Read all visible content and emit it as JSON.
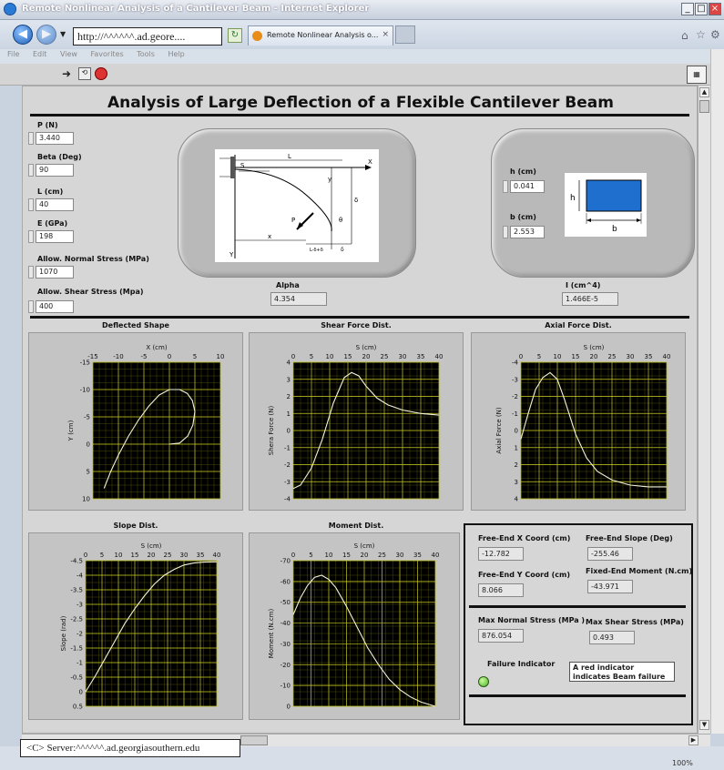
{
  "browser": {
    "title": "Remote Nonlinear Analysis of a Cantilever Beam - Internet Explorer",
    "url": "http://^^^^^^.ad.geore....",
    "tab": "Remote Nonlinear Analysis o...",
    "menu": [
      "File",
      "Edit",
      "View",
      "Favorites",
      "Tools",
      "Help"
    ],
    "status": "<C> Server:^^^^^^.ad.georgiasouthern.edu",
    "zoom": "100%",
    "icons": [
      "back-icon",
      "forward-icon",
      "refresh-icon",
      "home-icon",
      "star-icon",
      "gear-icon"
    ]
  },
  "app": {
    "title": "Analysis of Large Deflection of a Flexible Cantilever Beam",
    "inputs": [
      {
        "label": "P (N)",
        "value": "3.440"
      },
      {
        "label": "Beta (Deg)",
        "value": "90"
      },
      {
        "label": "L (cm)",
        "value": "40"
      },
      {
        "label": "E (GPa)",
        "value": "198"
      },
      {
        "label": "Allow. Normal Stress (MPa)",
        "value": "1070"
      },
      {
        "label": "Allow. Shear Stress (Mpa)",
        "value": "400"
      }
    ],
    "alpha": {
      "label": "Alpha",
      "value": "4.354"
    },
    "h": {
      "label": "h (cm)",
      "value": "0.041"
    },
    "b": {
      "label": "b (cm)",
      "value": "2.553"
    },
    "inertia": {
      "label": "I (cm^4)",
      "value": "1.466E-5"
    },
    "diagram_labels": {
      "L": "L",
      "x": "x",
      "y": "y",
      "X": "X",
      "Y": "Y",
      "S": "S",
      "P": "P",
      "theta": "θ",
      "delta": "δ",
      "dx": "L-δ+δ",
      "h": "h",
      "b": "b"
    },
    "results": {
      "free_x": {
        "label": "Free-End X Coord (cm)",
        "value": "-12.782"
      },
      "free_slope": {
        "label": "Free-End Slope (Deg)",
        "value": "-255.46"
      },
      "free_y": {
        "label": "Free-End Y Coord (cm)",
        "value": "8.066"
      },
      "fixed_moment": {
        "label": "Fixed-End Moment (N.cm)",
        "value": "-43.971"
      },
      "max_normal": {
        "label": "Max Normal Stress (MPa )",
        "value": "876.054"
      },
      "max_shear": {
        "label": "Max Shear Stress (MPa)",
        "value": "0.493"
      },
      "failure_label": "Failure Indicator",
      "failure_note": "A red indicator indicates Beam failure",
      "failure_color": "#4caf2a"
    }
  },
  "chart_data": [
    {
      "type": "line",
      "title": "Deflected Shape",
      "xlabel": "X (cm)",
      "ylabel": "Y (cm)",
      "xlim": [
        -15,
        10
      ],
      "ylim": [
        -15,
        10
      ],
      "xticks": [
        "-15",
        "-10",
        "-5",
        "0",
        "5",
        "10"
      ],
      "yticks": [
        "-15",
        "-10",
        "-5",
        "0",
        "5",
        "10"
      ],
      "y_reversed": true,
      "x": [
        -12.8,
        -11.5,
        -10,
        -8,
        -6,
        -4,
        -2,
        0,
        2,
        3.5,
        4.5,
        5,
        4.6,
        3.6,
        2,
        0
      ],
      "y": [
        8.1,
        5,
        2,
        -1.5,
        -4.5,
        -7,
        -9,
        -10,
        -10,
        -9.3,
        -8,
        -6,
        -3.5,
        -1.5,
        -0.2,
        0
      ]
    },
    {
      "type": "line",
      "title": "Shear Force Dist.",
      "xlabel": "S (cm)",
      "ylabel": "Shera Force (N)",
      "xlim": [
        0,
        40
      ],
      "ylim": [
        -4,
        4
      ],
      "xticks": [
        "0",
        "5",
        "10",
        "15",
        "20",
        "25",
        "30",
        "35",
        "40"
      ],
      "yticks": [
        "4",
        "3",
        "2",
        "1",
        "0",
        "-1",
        "-2",
        "-3",
        "-4"
      ],
      "x": [
        0,
        2,
        5,
        8,
        11,
        14,
        16,
        18,
        20,
        23,
        26,
        30,
        35,
        40
      ],
      "y": [
        -3.4,
        -3.2,
        -2.2,
        -0.5,
        1.6,
        3.1,
        3.4,
        3.2,
        2.6,
        1.9,
        1.5,
        1.2,
        1.0,
        0.9
      ]
    },
    {
      "type": "line",
      "title": "Axial Force Dist.",
      "xlabel": "S (cm)",
      "ylabel": "Axial Force (N)",
      "xlim": [
        0,
        40
      ],
      "ylim": [
        -4,
        4
      ],
      "xticks": [
        "0",
        "5",
        "10",
        "15",
        "20",
        "25",
        "30",
        "35",
        "40"
      ],
      "yticks": [
        "-4",
        "-3",
        "-2",
        "-1",
        "0",
        "1",
        "2",
        "3",
        "4"
      ],
      "y_reversed": true,
      "x": [
        0,
        2,
        4,
        6,
        8,
        10,
        12,
        15,
        18,
        21,
        25,
        30,
        35,
        40
      ],
      "y": [
        0.5,
        -1,
        -2.4,
        -3.1,
        -3.4,
        -3,
        -1.8,
        0.2,
        1.6,
        2.4,
        2.9,
        3.2,
        3.3,
        3.3
      ]
    },
    {
      "type": "line",
      "title": "Slope Dist.",
      "xlabel": "S (cm)",
      "ylabel": "Slope (rad)",
      "xlim": [
        0,
        40
      ],
      "ylim": [
        -4.5,
        0.5
      ],
      "xticks": [
        "0",
        "5",
        "10",
        "15",
        "20",
        "25",
        "30",
        "35",
        "40"
      ],
      "yticks": [
        "-4.5",
        "-4",
        "-3.5",
        "-3",
        "-2.5",
        "-2",
        "-1.5",
        "-1",
        "-0.5",
        "0",
        "0.5"
      ],
      "y_reversed": true,
      "x": [
        0,
        3,
        6,
        9,
        12,
        15,
        18,
        21,
        24,
        27,
        30,
        33,
        36,
        40
      ],
      "y": [
        0,
        -0.55,
        -1.15,
        -1.75,
        -2.35,
        -2.85,
        -3.3,
        -3.7,
        -4,
        -4.2,
        -4.35,
        -4.42,
        -4.45,
        -4.46
      ]
    },
    {
      "type": "line",
      "title": "Moment Dist.",
      "xlabel": "S (cm)",
      "ylabel": "Moment (N.cm)",
      "xlim": [
        0,
        40
      ],
      "ylim": [
        -70,
        0
      ],
      "xticks": [
        "0",
        "5",
        "10",
        "15",
        "20",
        "25",
        "30",
        "35",
        "40"
      ],
      "yticks": [
        "-70",
        "-60",
        "-50",
        "-40",
        "-30",
        "-20",
        "-10",
        "0"
      ],
      "y_reversed": true,
      "x": [
        0,
        2,
        4,
        6,
        8,
        10,
        12,
        15,
        18,
        21,
        24,
        27,
        30,
        33,
        36,
        40
      ],
      "y": [
        -44,
        -52,
        -58,
        -62,
        -63,
        -61,
        -57,
        -48,
        -38,
        -28,
        -20,
        -13,
        -8,
        -4.5,
        -2,
        0
      ]
    }
  ]
}
